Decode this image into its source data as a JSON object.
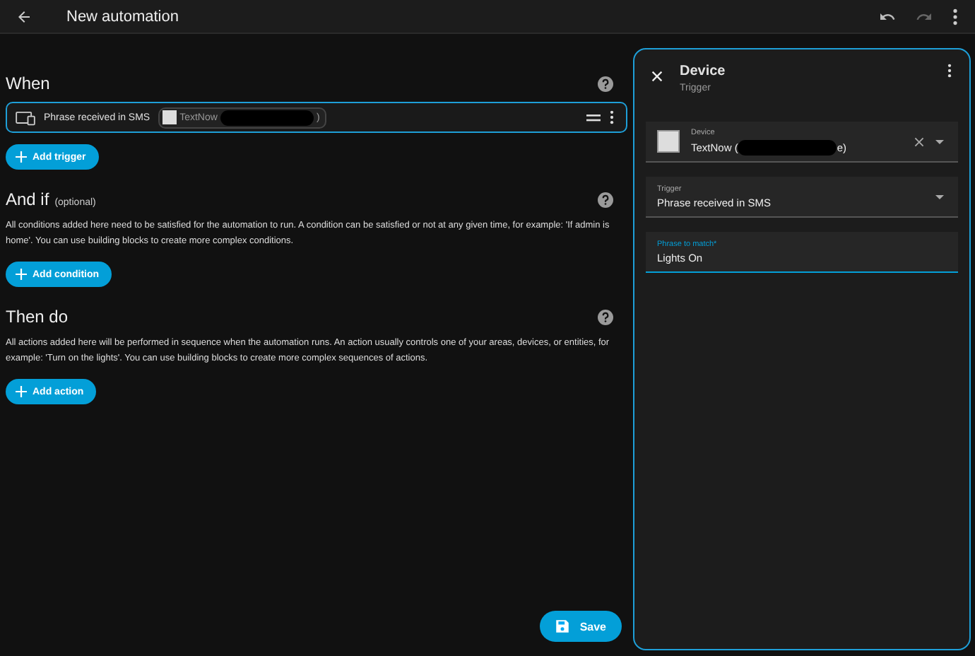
{
  "window": {
    "title": "New automation"
  },
  "sections": [
    {
      "kind": "trigger",
      "title": "When",
      "rows": [
        {
          "label": "Phrase received in SMS",
          "chip_before": "TextNow",
          "chip_after": ")"
        }
      ],
      "add_button": "Add trigger"
    },
    {
      "kind": "condition",
      "title": "And if",
      "note": "(optional)",
      "description": "All conditions added here need to be satisfied for the automation to run. A condition can be satisfied or not at any given time, for example: 'If admin is home'. You can use building blocks to create more complex conditions.",
      "add_button": "Add condition"
    },
    {
      "kind": "action",
      "title": "Then do",
      "description": "All actions added here will be performed in sequence when the automation runs. An action usually controls one of your areas, devices, or entities, for example: 'Turn on the lights'. You can use building blocks to create more complex sequences of actions.",
      "add_button": "Add action"
    }
  ],
  "save_button": "Save",
  "panel": {
    "title": "Device",
    "subtitle": "Trigger",
    "fields": [
      {
        "kind": "device",
        "label": "Device",
        "value_before": "TextNow (",
        "value_after": "e)",
        "focused": false
      },
      {
        "kind": "select",
        "label": "Trigger",
        "value": "Phrase received in SMS",
        "focused": false
      },
      {
        "kind": "text",
        "label": "Phrase to match*",
        "value": "Lights On",
        "focused": true
      }
    ]
  }
}
